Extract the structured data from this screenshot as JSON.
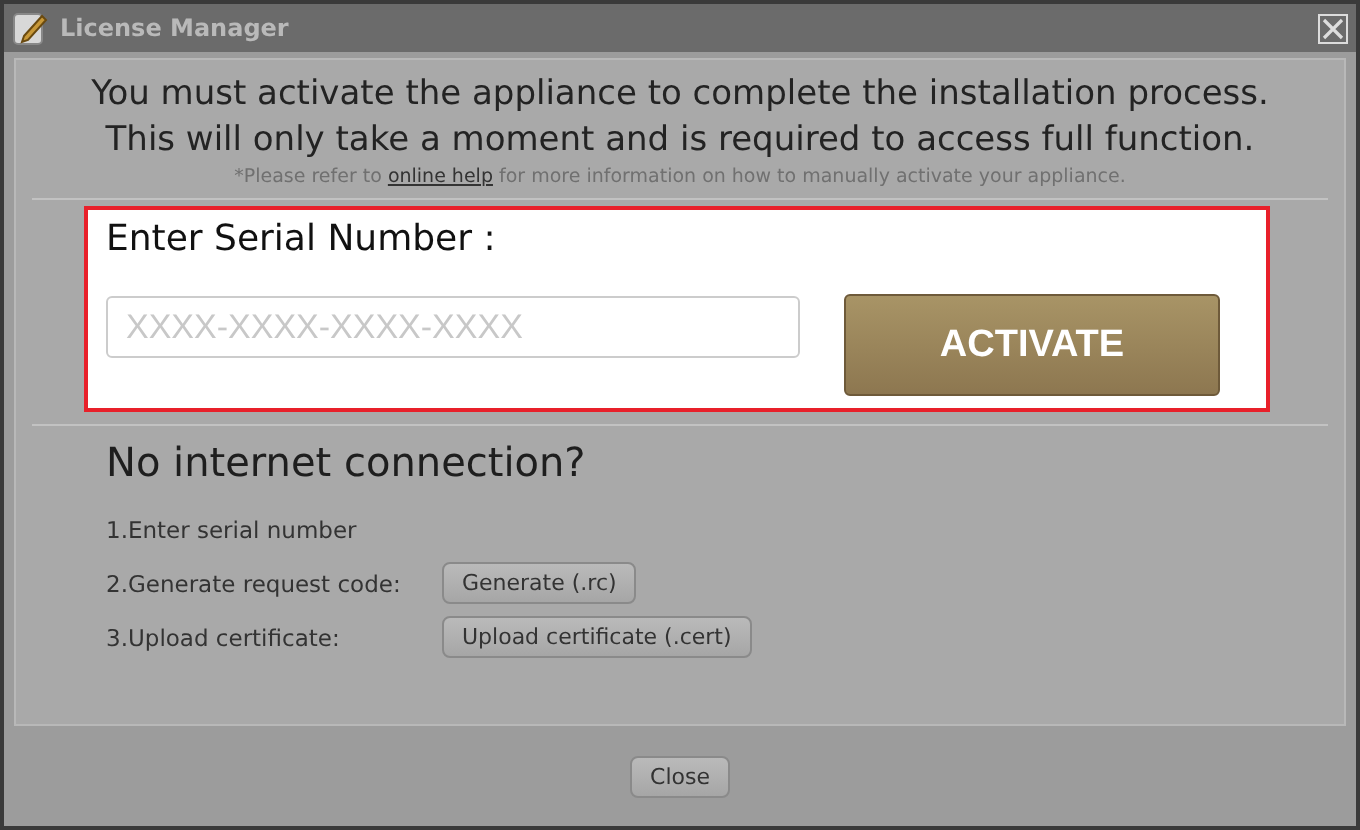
{
  "window": {
    "title": "License Manager"
  },
  "message": {
    "lines": [
      "You must activate the appliance to complete the installation process.",
      "This will only take a moment and is required to access full function."
    ],
    "note_before": "*Please refer to ",
    "note_link": "online help",
    "note_after": " for more information on how to manually activate your appliance."
  },
  "serial": {
    "label": "Enter Serial Number :",
    "placeholder": "XXXX-XXXX-XXXX-XXXX",
    "button": "ACTIVATE"
  },
  "offline": {
    "heading": "No internet connection?",
    "steps": [
      {
        "kind": "text",
        "label": "1.Enter serial number"
      },
      {
        "kind": "button",
        "label": "2.Generate request code:",
        "button": "Generate (.rc)"
      },
      {
        "kind": "button",
        "label": "3.Upload certificate:",
        "button": "Upload certificate (.cert)"
      }
    ]
  },
  "footer": {
    "button": "Close"
  }
}
